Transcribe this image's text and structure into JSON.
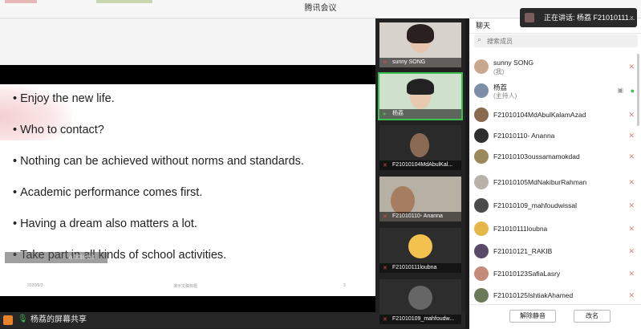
{
  "window": {
    "title": "腾讯会议"
  },
  "speaking_banner": {
    "text": "正在讲话: 杨荔 F21010111...",
    "close": "×"
  },
  "slide": {
    "bullets": [
      "Enjoy the new life.",
      "Who to contact?",
      "Nothing can be achieved without norms and standards.",
      "Academic performance comes first.",
      "Having a dream also matters a lot.",
      "Take part in all kinds of school activities."
    ],
    "footer_date": "2020/9/3",
    "footer_center": "演示文稿标题",
    "footer_page": "3",
    "overlay_text": "a little bit"
  },
  "bottom_bar": {
    "share_text": "杨荔的屏幕共享"
  },
  "gallery": [
    {
      "name": "sunny SONG"
    },
    {
      "name": "杨荔"
    },
    {
      "name": "F21010104MdAbulKal..."
    },
    {
      "name": "F21010110- Ananna"
    },
    {
      "name": "F21010111loubna"
    },
    {
      "name": "F21010109_mahfoudw..."
    }
  ],
  "chat_panel": {
    "title": "聊天",
    "search_placeholder": "搜索成员",
    "members": [
      {
        "name": "sunny SONG",
        "sub": "(我)",
        "color": "#c9a88f"
      },
      {
        "name": "杨荔",
        "sub": "(主持人)",
        "color": "#7d8fa8"
      },
      {
        "name": "F21010104MdAbulKalamAzad",
        "color": "#8a6a4f"
      },
      {
        "name": "F21010110- Ananna",
        "color": "#2e2e2e"
      },
      {
        "name": "F21010103oussamamokdad",
        "color": "#9a8a5a"
      },
      {
        "name": "F21010105MdNakiburRahman",
        "color": "#b9b2a8"
      },
      {
        "name": "F21010109_mahfoudwissal",
        "color": "#4a4a4a"
      },
      {
        "name": "F21010111loubna",
        "color": "#e6b84a"
      },
      {
        "name": "F21010121_RAKIB",
        "color": "#5a4a6a"
      },
      {
        "name": "F21010123SafiaLasry",
        "color": "#c48a7a"
      },
      {
        "name": "F21010125IshtiakAhamed",
        "color": "#6b7a5a"
      }
    ],
    "unmute_all": "解除静音",
    "rename": "改名"
  }
}
